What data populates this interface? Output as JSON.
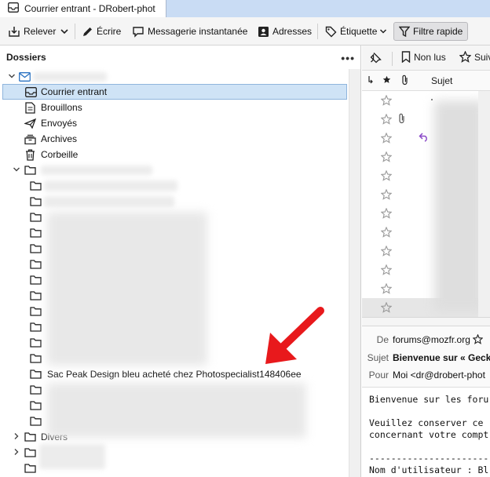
{
  "tab": {
    "title": "Courrier entrant - DRobert-phot"
  },
  "toolbar": {
    "get_messages": "Relever",
    "write": "Écrire",
    "chat": "Messagerie instantanée",
    "address_book": "Adresses",
    "tag": "Étiquette",
    "quick_filter": "Filtre rapide"
  },
  "folder_pane": {
    "title": "Dossiers",
    "more": "•••",
    "folders": {
      "inbox": "Courrier entrant",
      "drafts": "Brouillons",
      "sent": "Envoyés",
      "archives": "Archives",
      "trash": "Corbeille"
    },
    "highlighted_folder": "Sac Peak Design bleu acheté chez Photospecialist148406ee",
    "divers": "Divers"
  },
  "quick_filter_bar": {
    "unread": "Non lus",
    "starred": "Suiv"
  },
  "thread_columns": {
    "subject": "Sujet"
  },
  "message_header": {
    "from_label": "De",
    "from_value": "forums@mozfr.org",
    "subject_label": "Sujet",
    "subject_value": "Bienvenue sur « Gecko",
    "to_label": "Pour",
    "to_value": "Moi <dr@drobert-phot"
  },
  "message_body": {
    "line1": "Bienvenue sur les foru",
    "line2": "Veuillez conserver ce",
    "line3": "concernant votre compt",
    "line4": "----------------------",
    "line5": "Nom d'utilisateur : Bl"
  },
  "colors": {
    "accent": "#2a72c2",
    "selection": "#cfe3f6",
    "arrow": "#e8191c",
    "reply": "#8a48c8"
  }
}
